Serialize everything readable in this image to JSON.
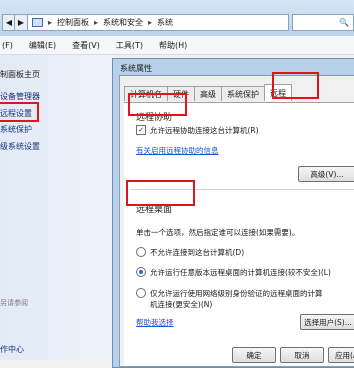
{
  "address_bar": {
    "path": [
      "控制面板",
      "系统和安全",
      "系统"
    ],
    "separator": "▸",
    "back_glyph": "◀",
    "forward_glyph": "▶",
    "search_glyph": "🔍"
  },
  "menu": {
    "items": [
      "(F)",
      "编辑(E)",
      "查看(V)",
      "工具(T)",
      "帮助(H)"
    ]
  },
  "sidebar": {
    "items": [
      "制面板主页",
      "设备管理器",
      "远程设置",
      "系统保护",
      "级系统设置"
    ],
    "see_also": "另请参阅",
    "action_center": "作中心"
  },
  "dialog": {
    "title": "系统属性",
    "tabs": [
      "计算机名",
      "硬件",
      "高级",
      "系统保护",
      "远程"
    ],
    "remote_assistance": {
      "heading": "远程协助",
      "checkbox_label": "允许远程协助连接这台计算机(R)",
      "checked": true,
      "link": "有关启用远程协助的信息",
      "advanced_button": "高级(V)..."
    },
    "remote_desktop": {
      "heading": "远程桌面",
      "instruction": "单击一个选项，然后指定谁可以连接(如果需要)。",
      "options": [
        {
          "label": "不允许连接到这台计算机(D)",
          "selected": false
        },
        {
          "label": "允许运行任意版本远程桌面的计算机连接(较不安全)(L)",
          "selected": true
        },
        {
          "label": "仅允许运行使用网络级别身份验证的远程桌面的计算",
          "label2": "机连接(更安全)(N)",
          "selected": false
        }
      ],
      "help_link": "帮助我选择",
      "select_users_button": "选择用户(S)..."
    },
    "buttons": {
      "ok": "确定",
      "cancel": "取消",
      "apply": "应用(A)"
    }
  }
}
